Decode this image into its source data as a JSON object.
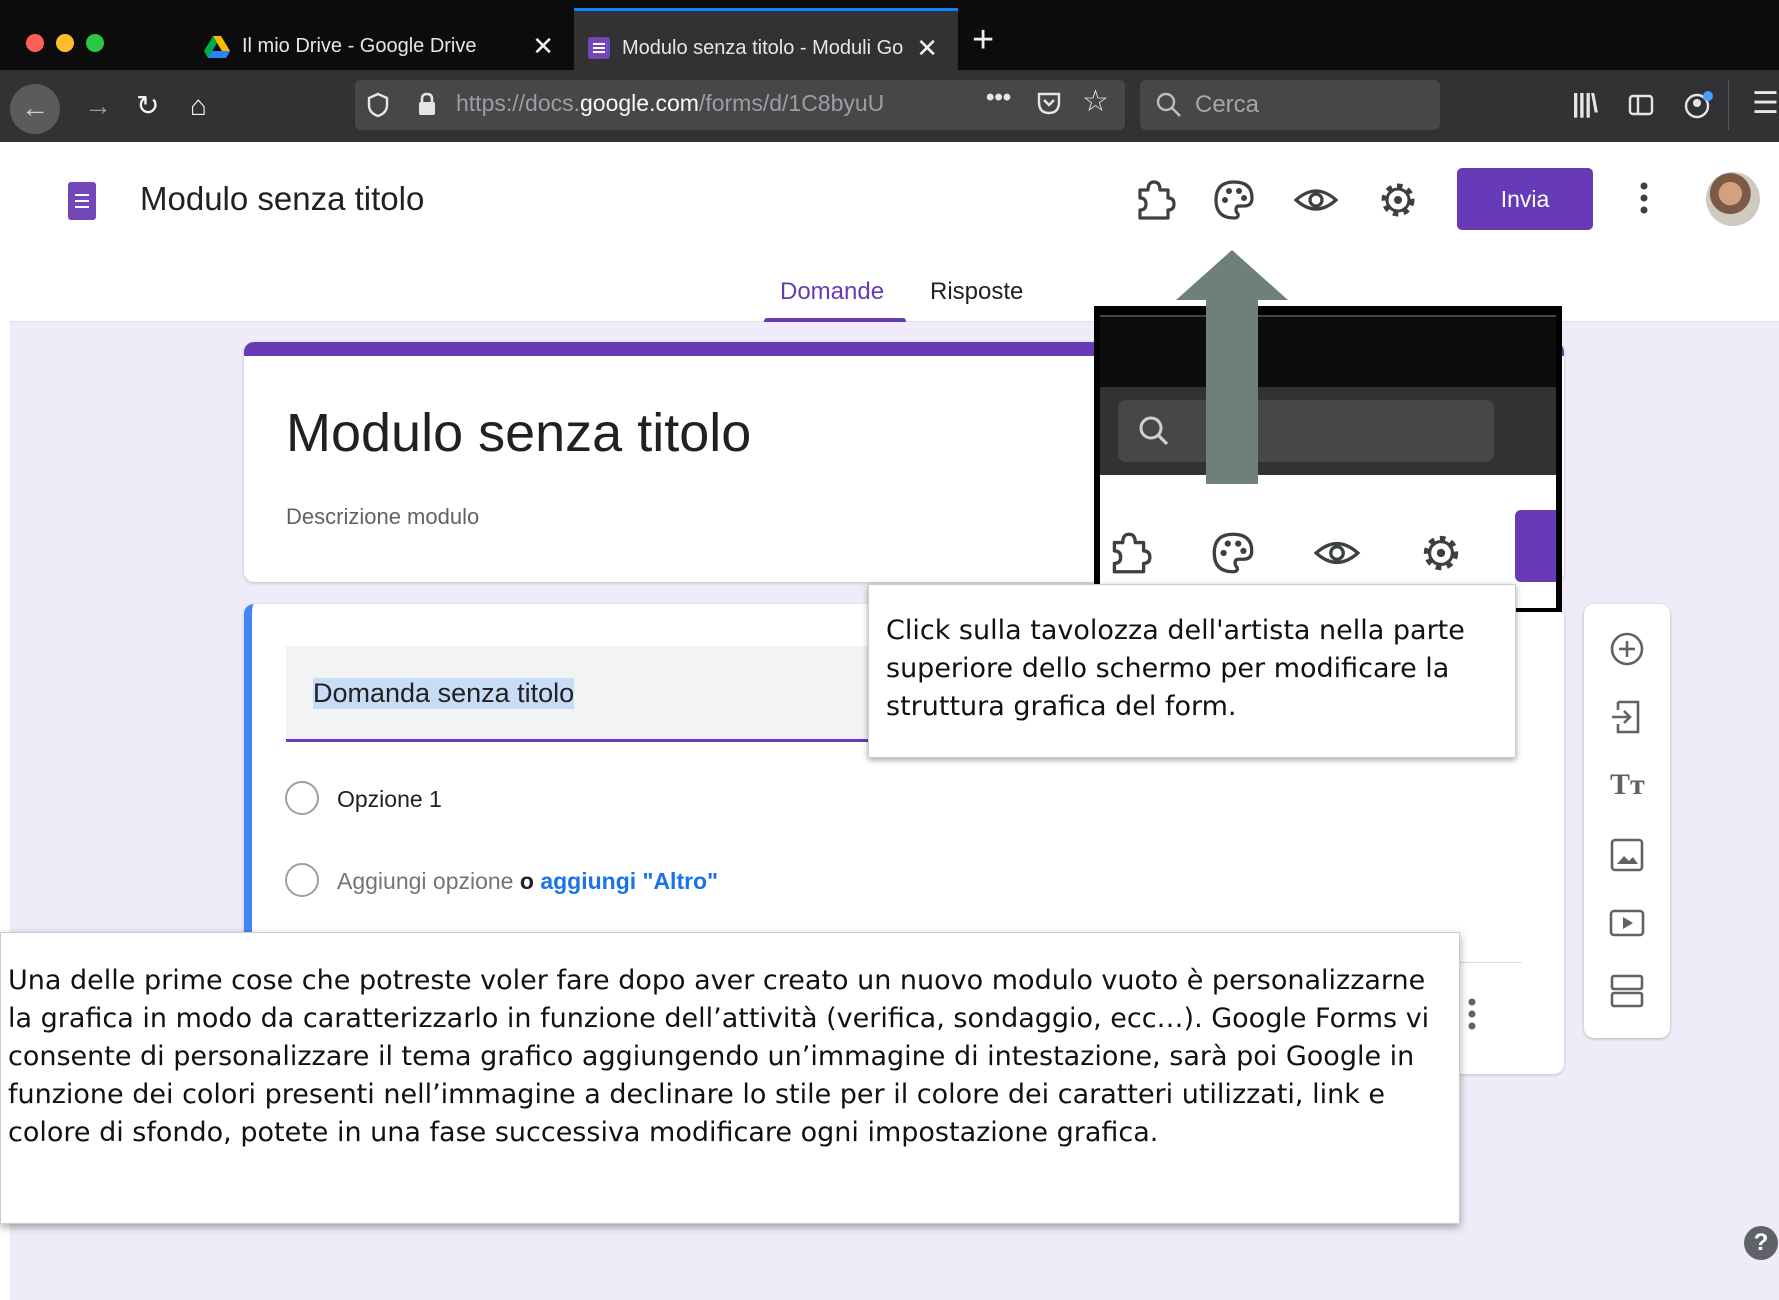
{
  "browser": {
    "tabs": [
      {
        "title": "Il mio Drive - Google Drive",
        "icon": "google-drive-icon",
        "active": false
      },
      {
        "title": "Modulo senza titolo - Moduli Go",
        "icon": "google-forms-icon",
        "active": true
      }
    ],
    "new_tab_icon": "plus-icon",
    "url_prefix": "https://docs.",
    "url_domain": "google.com",
    "url_suffix": "/forms/d/1C8byuU",
    "search_placeholder": "Cerca",
    "accent": "#0a84ff"
  },
  "forms": {
    "app_title": "Modulo senza titolo",
    "send_label": "Invia",
    "tabs": [
      "Domande",
      "Risposte"
    ],
    "form_title": "Modulo senza titolo",
    "form_description": "Descrizione modulo",
    "question": "Domanda senza titolo",
    "option1": "Opzione 1",
    "add_option": "Aggiungi opzione",
    "or": "o",
    "add_other": "aggiungi \"Altro\"",
    "header_icons": [
      "addons-icon",
      "palette-icon",
      "eye-icon",
      "gear-icon",
      "more-vert-icon"
    ],
    "side_icons": [
      "add-circle-icon",
      "import-icon",
      "title-text-icon",
      "image-icon",
      "video-icon",
      "section-icon"
    ],
    "accent": "#673ab7",
    "question_accent": "#4285f4",
    "background": "#f0ebf8"
  },
  "annotations": {
    "callout": "Click sulla tavolozza dell'artista nella parte superiore dello schermo per modificare la struttura grafica del form.",
    "explanation": "Una delle prime cose che potreste voler fare dopo aver creato un nuovo modulo vuoto è personalizzarne la grafica in modo da caratterizzarlo in funzione dell’attività (verifica, sondaggio, ecc…). Google Forms vi consente di personalizzare il tema grafico aggiungendo un’immagine di intestazione, sarà poi Google in funzione dei colori presenti nell’immagine a declinare lo stile per il colore dei caratteri utilizzati, link e colore di sfondo, potete in una fase successiva modificare ogni impostazione grafica.",
    "arrow_color": "#6e8079"
  },
  "help_glyph": "?"
}
